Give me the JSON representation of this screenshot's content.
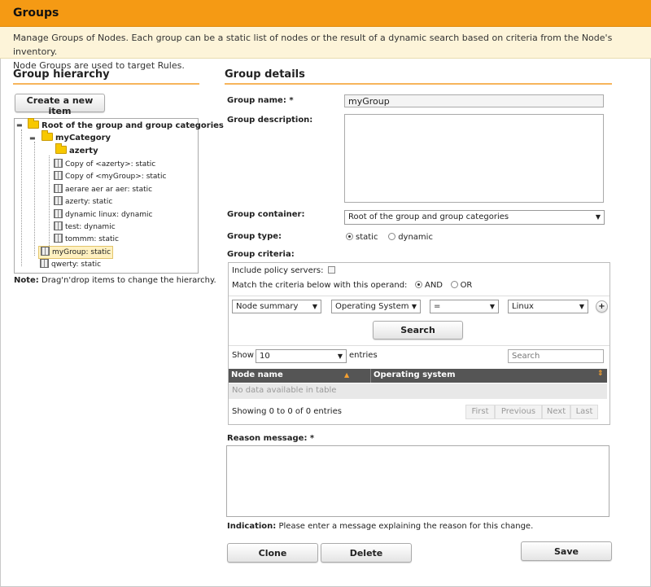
{
  "header": {
    "title": "Groups"
  },
  "description": {
    "line1": "Manage Groups of Nodes. Each group can be a static list of nodes or the result of a dynamic search based on criteria from the Node's inventory.",
    "line2": "Node Groups are used to target Rules."
  },
  "hierarchy": {
    "title": "Group hierarchy",
    "create_label": "Create a new item",
    "root": "Root of the group and group categories",
    "category": "myCategory",
    "subcategory": "azerty",
    "items": [
      "Copy of <azerty>: static",
      "Copy of <myGroup>: static",
      "aerare aer ar aer: static",
      "azerty: static",
      "dynamic linux: dynamic",
      "test: dynamic",
      "tommm: static"
    ],
    "selected_item": "myGroup: static",
    "last_item": "qwerty: static",
    "note_label": "Note:",
    "note_text": "Drag'n'drop items to change the hierarchy."
  },
  "details": {
    "title": "Group details",
    "name_label": "Group name: *",
    "name_value": "myGroup",
    "description_label": "Group description:",
    "description_value": "",
    "container_label": "Group container:",
    "container_value": "Root of the group and group categories",
    "type_label": "Group type:",
    "type_static": "static",
    "type_dynamic": "dynamic",
    "criteria_label": "Group criteria:"
  },
  "criteria": {
    "include_policy": "Include policy servers:",
    "operand_text": "Match the criteria below with this operand:",
    "and_label": "AND",
    "or_label": "OR",
    "object_value": "Node summary",
    "attribute_value": "Operating System",
    "comparator_value": "=",
    "value_value": "Linux",
    "add_label": "+",
    "search_label": "Search"
  },
  "table": {
    "show_label": "Show",
    "entries_value": "10",
    "entries_label": "entries",
    "search_placeholder": "Search",
    "columns": [
      "Node name",
      "Operating system"
    ],
    "empty_text": "No data available in table",
    "info_text": "Showing 0 to 0 of 0 entries",
    "pager": [
      "First",
      "Previous",
      "Next",
      "Last"
    ]
  },
  "reason": {
    "label": "Reason message: *",
    "value": "",
    "indication_label": "Indication:",
    "indication_text": "Please enter a message explaining the reason for this change."
  },
  "actions": {
    "clone": "Clone",
    "delete": "Delete",
    "save": "Save"
  },
  "colors": {
    "header_bg": "#f59a14",
    "desc_bg": "#fdf4d9",
    "accent_line": "#f7b55b",
    "grid_header": "#555555"
  }
}
